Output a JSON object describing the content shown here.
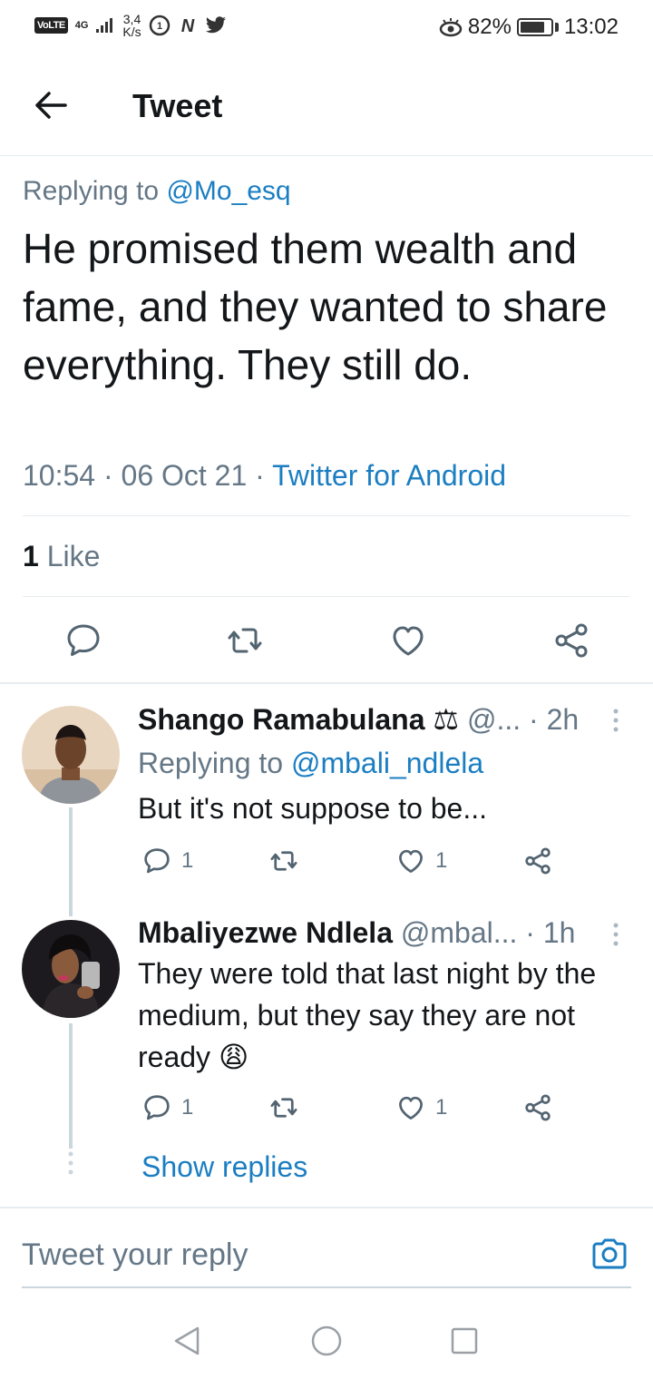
{
  "status_bar": {
    "volte": "VoLTE",
    "network": "4G",
    "speed_top": "3,4",
    "speed_bottom": "K/s",
    "battery_percent": "82%",
    "battery_level": 0.82,
    "time": "13:02"
  },
  "header": {
    "title": "Tweet"
  },
  "tweet": {
    "replying_prefix": "Replying to ",
    "replying_handle": "@Mo_esq",
    "text": "He promised them wealth and fame, and they wanted to share everything. They still do.",
    "time": "10:54",
    "date": "06 Oct 21",
    "source": "Twitter for Android",
    "like_count": "1",
    "like_label": " Like"
  },
  "replies": [
    {
      "name": "Shango Ramabulana ⚖",
      "handle": " @...",
      "age": " · 2h",
      "replying_prefix": "Replying to ",
      "replying_handle": "@mbali_ndlela",
      "text": "But it's not suppose to be...",
      "reply_count": "1",
      "like_count": "1"
    },
    {
      "name": "Mbaliyezwe Ndlela",
      "handle": " @mbal...",
      "age": " · 1h",
      "text": "They were told that last night by the medium, but they say they are not ready 😩",
      "reply_count": "1",
      "like_count": "1"
    }
  ],
  "show_replies": "Show replies",
  "composer": {
    "placeholder": "Tweet your reply"
  },
  "icons": {
    "back": "arrow-left-icon",
    "reply": "speech-bubble-icon",
    "retweet": "retweet-icon",
    "like": "heart-icon",
    "share": "share-icon",
    "camera": "camera-icon"
  },
  "colors": {
    "link": "#1b7ec2",
    "muted": "#657786",
    "text": "#14171a",
    "divider": "#e6ecf0"
  }
}
